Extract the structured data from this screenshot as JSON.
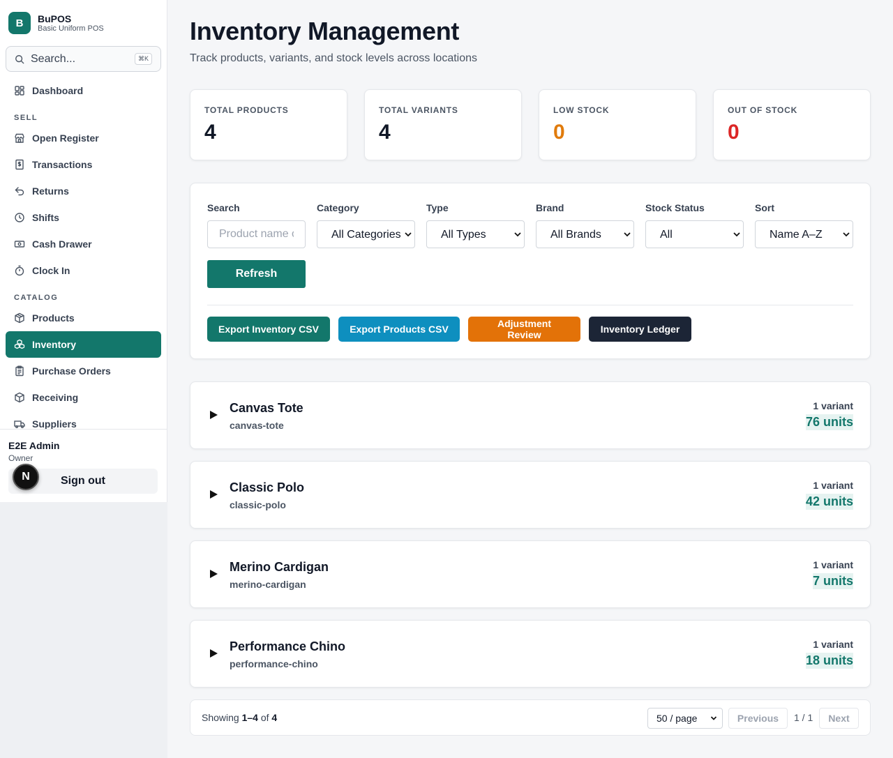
{
  "brand": {
    "logo_letter": "B",
    "name": "BuPOS",
    "subtitle": "Basic Uniform POS"
  },
  "sidebar": {
    "search_placeholder": "Search...",
    "search_shortcut": "⌘K",
    "dashboard": "Dashboard",
    "sections": {
      "sell": "SELL",
      "catalog": "CATALOG"
    },
    "sell_items": [
      "Open Register",
      "Transactions",
      "Returns",
      "Shifts",
      "Cash Drawer",
      "Clock In"
    ],
    "catalog_items": [
      "Products",
      "Inventory",
      "Purchase Orders",
      "Receiving",
      "Suppliers"
    ],
    "active_item": "Inventory"
  },
  "user": {
    "name": "E2E Admin",
    "role": "Owner",
    "signout_label": "Sign out",
    "dev_badge": "N"
  },
  "page": {
    "title": "Inventory Management",
    "subtitle": "Track products, variants, and stock levels across locations"
  },
  "stats": [
    {
      "label": "TOTAL PRODUCTS",
      "value": "4",
      "color": "#111827"
    },
    {
      "label": "TOTAL VARIANTS",
      "value": "4",
      "color": "#111827"
    },
    {
      "label": "LOW STOCK",
      "value": "0",
      "color": "#e07b0c"
    },
    {
      "label": "OUT OF STOCK",
      "value": "0",
      "color": "#dc2626"
    }
  ],
  "filters": {
    "search_label": "Search",
    "search_placeholder": "Product name or SKU",
    "category_label": "Category",
    "category_value": "All Categories",
    "type_label": "Type",
    "type_value": "All Types",
    "brand_label": "Brand",
    "brand_value": "All Brands",
    "stock_label": "Stock Status",
    "stock_value": "All",
    "sort_label": "Sort",
    "sort_value": "Name A–Z",
    "refresh_label": "Refresh"
  },
  "actions": {
    "export_inventory": "Export Inventory CSV",
    "export_products": "Export Products CSV",
    "adjustment_review": "Adjustment Review",
    "inventory_ledger": "Inventory Ledger"
  },
  "colors": {
    "primary": "#13776b",
    "cyan": "#0e8fbf",
    "orange": "#e37208",
    "navy": "#1c2536"
  },
  "products": [
    {
      "name": "Canvas Tote",
      "slug": "canvas-tote",
      "variants": "1 variant",
      "units": "76 units"
    },
    {
      "name": "Classic Polo",
      "slug": "classic-polo",
      "variants": "1 variant",
      "units": "42 units"
    },
    {
      "name": "Merino Cardigan",
      "slug": "merino-cardigan",
      "variants": "1 variant",
      "units": "7 units"
    },
    {
      "name": "Performance Chino",
      "slug": "performance-chino",
      "variants": "1 variant",
      "units": "18 units"
    }
  ],
  "pagination": {
    "showing_prefix": "Showing",
    "range": "1–4",
    "of": "of",
    "total": "4",
    "page_size": "50 / page",
    "previous": "Previous",
    "page_indicator": "1 / 1",
    "next": "Next"
  }
}
